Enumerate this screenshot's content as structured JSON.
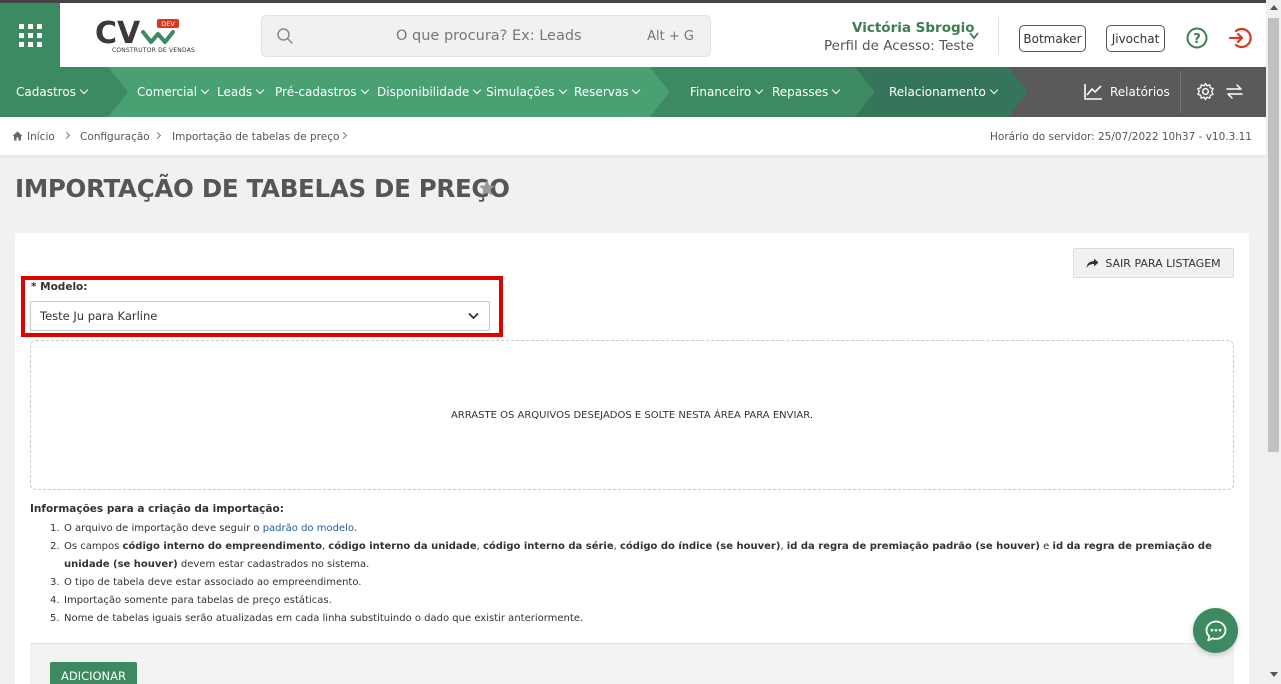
{
  "header": {
    "logo_text": "CV",
    "logo_badge": "DEV",
    "logo_subtitle": "CONSTRUTOR DE VENDAS",
    "search_placeholder": "O que procura? Ex: Leads",
    "search_shortcut": "Alt + G",
    "user_name": "Victória Sbrogio",
    "user_profile": "Perfil de Acesso: Teste",
    "botmaker_label": "Botmaker",
    "jivochat_label": "Jivochat"
  },
  "nav": {
    "items": [
      {
        "label": "Cadastros"
      },
      {
        "label": "Comercial"
      },
      {
        "label": "Leads"
      },
      {
        "label": "Pré-cadastros"
      },
      {
        "label": "Disponibilidade"
      },
      {
        "label": "Simulações"
      },
      {
        "label": "Reservas"
      },
      {
        "label": "Financeiro"
      },
      {
        "label": "Repasses"
      },
      {
        "label": "Relacionamento"
      }
    ],
    "reports_label": "Relatórios",
    "colors": {
      "segment1": "#3d8a62",
      "segment2": "#48a073",
      "segment3": "#3d8a62",
      "segment4": "#35755a",
      "rest": "#5a5a5a"
    }
  },
  "breadcrumb": {
    "items": [
      "Início",
      "Configuração",
      "Importação de tabelas de preço"
    ],
    "server_time": "Horário do servidor: 25/07/2022 10h37 - v10.3.11"
  },
  "page": {
    "title": "IMPORTAÇÃO DE TABELAS DE PREÇO",
    "exit_button": "SAIR PARA LISTAGEM",
    "model_label": "* Modelo:",
    "model_value": "Teste Ju para Karline",
    "dropzone_text": "ARRASTE OS ARQUIVOS DESEJADOS E SOLTE NESTA ÁREA PARA ENVIAR.",
    "info_title": "Informações para a criação da importação:",
    "info": {
      "n1": "1.",
      "i1_text": "O arquivo de importação deve seguir o ",
      "i1_link": "padrão do modelo",
      "i1_end": ".",
      "n2": "2.",
      "i2_a": "Os campos ",
      "i2_b1": "código interno do empreendimento",
      "i2_c1": ", ",
      "i2_b2": "código interno da unidade",
      "i2_c2": ", ",
      "i2_b3": "código interno da série",
      "i2_c3": ", ",
      "i2_b4": "código do índice (se houver)",
      "i2_c4": ", ",
      "i2_b5": "id da regra de premiação padrão (se houver)",
      "i2_c5": " e ",
      "i2_b6": "id da regra de premiação de unidade (se houver)",
      "i2_end": " devem estar cadastrados no sistema.",
      "n3": "3.",
      "i3": "O tipo de tabela deve estar associado ao empreendimento.",
      "n4": "4.",
      "i4": "Importação somente para tabelas de preço estáticas.",
      "n5": "5.",
      "i5": "Nome de tabelas iguais serão atualizadas em cada linha substituindo o dado que existir anteriormente."
    },
    "add_button": "ADICIONAR"
  },
  "colors": {
    "brand_green": "#3d8a62",
    "user_name_green": "#3d7d4f",
    "highlight_red": "#e00000",
    "exit_red": "#d9381e",
    "link_blue": "#1f5fa8"
  }
}
